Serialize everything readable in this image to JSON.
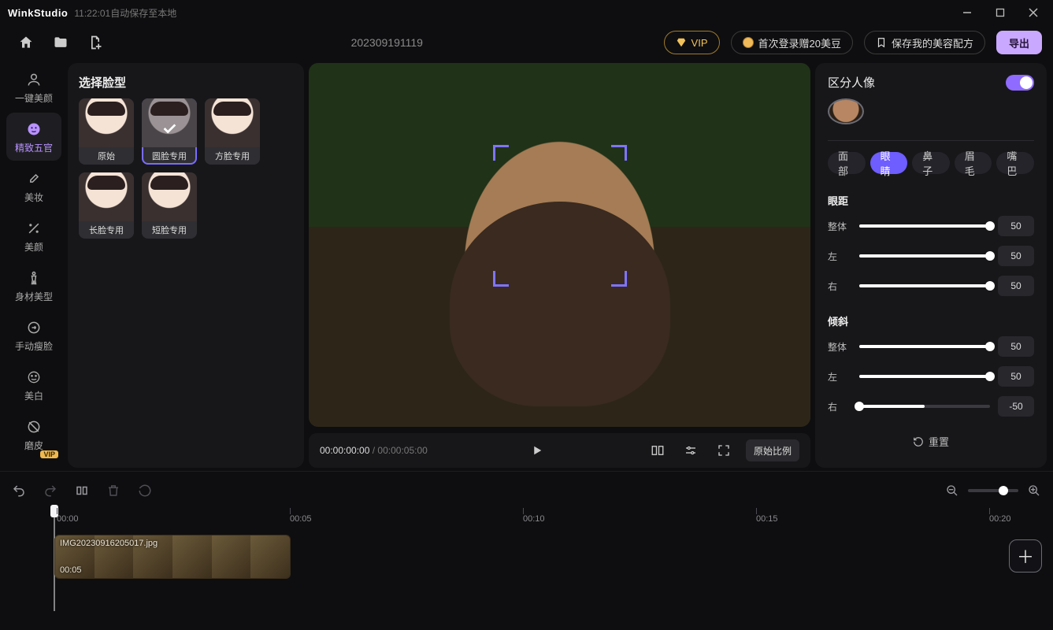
{
  "app": {
    "name": "WinkStudio",
    "autosave": "11:22:01自动保存至本地"
  },
  "doc": {
    "title": "202309191119"
  },
  "header": {
    "vip": "VIP",
    "login": "首次登录赠20美豆",
    "saveRecipe": "保存我的美容配方",
    "export": "导出"
  },
  "nav": {
    "items": [
      {
        "label": "一键美颜"
      },
      {
        "label": "精致五官"
      },
      {
        "label": "美妆"
      },
      {
        "label": "美颜"
      },
      {
        "label": "身材美型"
      },
      {
        "label": "手动瘦脸"
      },
      {
        "label": "美白"
      },
      {
        "label": "磨皮"
      }
    ],
    "vipBadge": "VIP"
  },
  "facePanel": {
    "title": "选择脸型",
    "options": [
      {
        "label": "原始"
      },
      {
        "label": "圆脸专用"
      },
      {
        "label": "方脸专用"
      },
      {
        "label": "长脸专用"
      },
      {
        "label": "短脸专用"
      }
    ]
  },
  "player": {
    "current": "00:00:00:00",
    "sep": " / ",
    "duration": "00:00:05:00",
    "ratio": "原始比例"
  },
  "right": {
    "title": "区分人像",
    "tabs": [
      "面部",
      "眼睛",
      "鼻子",
      "眉毛",
      "嘴巴"
    ],
    "group1": "眼距",
    "group2": "倾斜",
    "labels": {
      "all": "整体",
      "left": "左",
      "right": "右"
    },
    "vals": {
      "d_all": "50",
      "d_left": "50",
      "d_right": "50",
      "t_all": "50",
      "t_left": "50",
      "t_right": "-50"
    },
    "reset": "重置"
  },
  "timeline": {
    "marks": [
      "00:00",
      "00:05",
      "00:10",
      "00:15",
      "00:20"
    ],
    "clip": {
      "name": "IMG20230916205017.jpg",
      "dur": "00:05"
    }
  }
}
